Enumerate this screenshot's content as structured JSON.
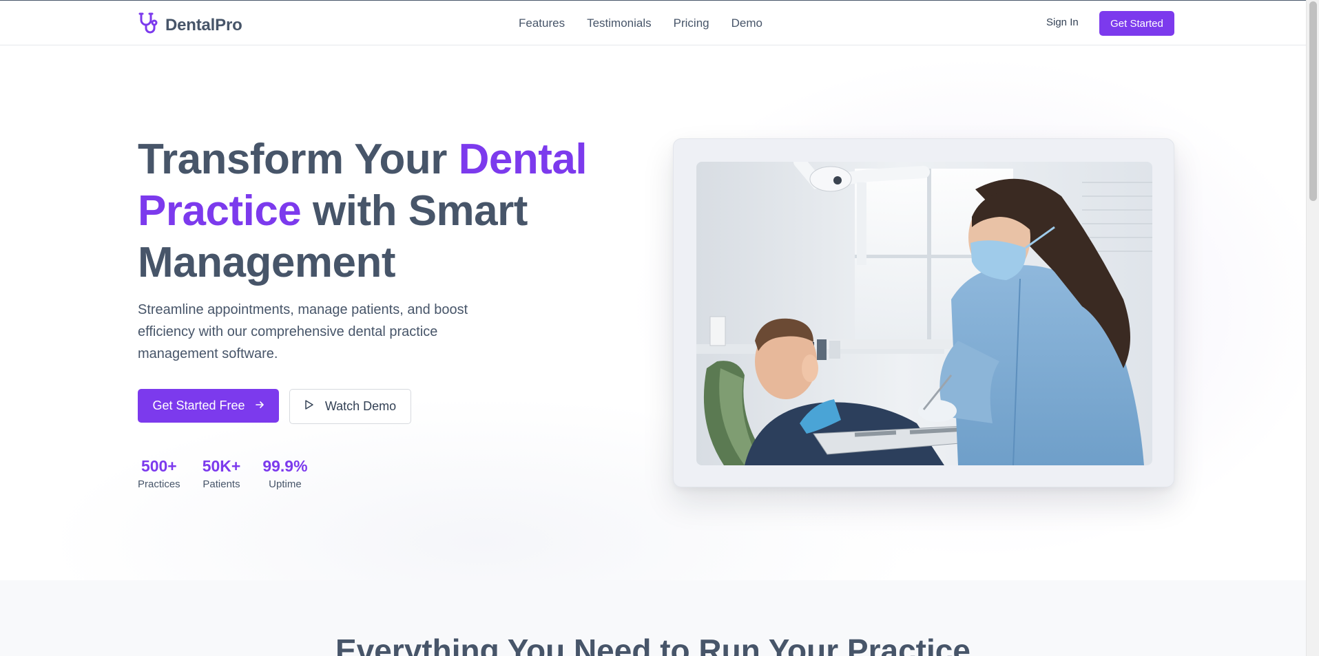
{
  "brand": {
    "name": "DentalPro",
    "color": "#7c3aed",
    "icon": "stethoscope-icon"
  },
  "nav": {
    "links": [
      "Features",
      "Testimonials",
      "Pricing",
      "Demo"
    ],
    "sign_in": "Sign In",
    "cta": "Get Started"
  },
  "hero": {
    "headline": {
      "part1": "Transform Your ",
      "accent1": "Dental",
      "accent2": "Practice",
      "part2": " with Smart Management"
    },
    "subtext": "Streamline appointments, manage patients, and boost efficiency with our comprehensive dental practice management software.",
    "primary_button": {
      "label": "Get Started Free",
      "icon": "arrow-right-icon"
    },
    "secondary_button": {
      "label": "Watch Demo",
      "icon": "play-icon"
    },
    "stats": [
      {
        "value": "500+",
        "label": "Practices"
      },
      {
        "value": "50K+",
        "label": "Patients"
      },
      {
        "value": "99.9%",
        "label": "Uptime"
      }
    ],
    "image": {
      "subject": "dentist-with-patient-photo"
    }
  },
  "features": {
    "title": "Everything You Need to Run Your Practice"
  }
}
